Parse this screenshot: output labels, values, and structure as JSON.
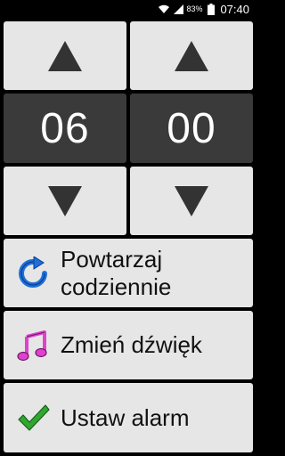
{
  "status_bar": {
    "battery_percent": "83%",
    "time": "07:40",
    "icons": [
      "wifi-icon",
      "signal-icon",
      "battery-icon"
    ]
  },
  "time_picker": {
    "hours": "06",
    "minutes": "00",
    "controls": [
      "increase-hours",
      "increase-minutes",
      "decrease-hours",
      "decrease-minutes"
    ]
  },
  "actions": [
    {
      "label": "Powtarzaj codziennie",
      "icon": "repeat-icon"
    },
    {
      "label": "Zmień dźwięk",
      "icon": "music-note-icon"
    },
    {
      "label": "Ustaw alarm",
      "icon": "checkmark-icon"
    }
  ],
  "colors": {
    "background": "#000000",
    "tile": "#e6e6e6",
    "digit_tile": "#3a3a3a",
    "repeat_icon": "#1e6fd8",
    "music_icon": "#e040d0",
    "check_icon": "#2ea82e"
  }
}
